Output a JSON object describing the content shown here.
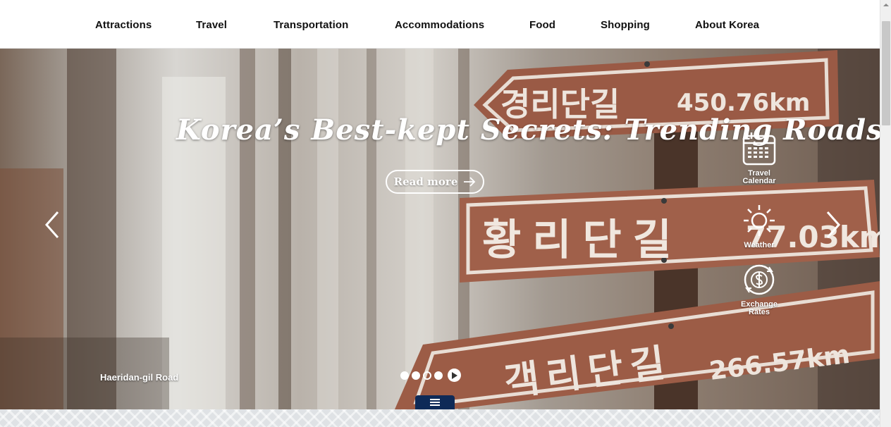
{
  "nav": {
    "items": [
      {
        "label": "Attractions"
      },
      {
        "label": "Travel"
      },
      {
        "label": "Transportation"
      },
      {
        "label": "Accommodations"
      },
      {
        "label": "Food"
      },
      {
        "label": "Shopping"
      },
      {
        "label": "About Korea"
      }
    ]
  },
  "hero": {
    "title": "Korea’s Best-kept Secrets: Trending Roads",
    "read_more_label": "Read more",
    "caption": "Haeridan-gil Road",
    "signs": [
      {
        "road": "경리단길",
        "distance": "450.76km"
      },
      {
        "road": "황리단길",
        "distance": "77.03km"
      },
      {
        "road": "객리단길",
        "distance": "266.57km"
      }
    ],
    "slides": {
      "count": 4,
      "active_index": 2
    }
  },
  "quick_links": [
    {
      "label": "Travel Calendar",
      "icon": "calendar-icon"
    },
    {
      "label": "Weather",
      "icon": "sun-icon"
    },
    {
      "label": "Exchange Rates",
      "icon": "currency-exchange-icon"
    }
  ],
  "colors": {
    "menu_tab": "#0e2a57",
    "sign_wood": "#9a5a45",
    "pattern_strip": "#dfe2e5"
  }
}
